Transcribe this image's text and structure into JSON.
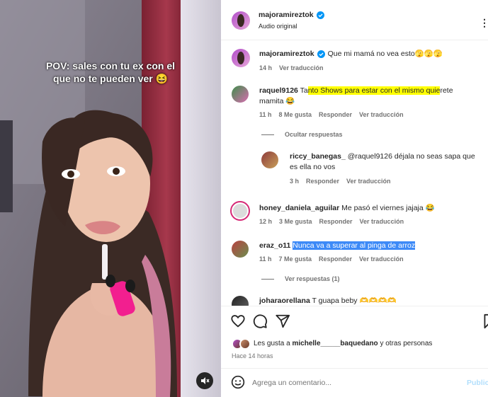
{
  "video": {
    "caption_line1": "POV: sales con tu ex con el",
    "caption_line2": "que no te pueden ver 😆",
    "mute_icon": "speaker-muted-icon"
  },
  "header": {
    "username": "majoramireztok",
    "verified_icon": "verified-badge-icon",
    "audio": "Audio original",
    "more_icon": "more-options-icon"
  },
  "caption": {
    "username": "majoramireztok",
    "text": "Que mi mamá no vea esto🫣🫣🫣",
    "time": "14 h",
    "translate": "Ver traducción"
  },
  "comments": [
    {
      "username": "raquel9126",
      "text_pre": "Ta",
      "text_highlight": "nto Shows para estar con el mismo quie",
      "text_post": "rete mamita 😂",
      "highlight_color": "#ffff00",
      "time": "11 h",
      "likes": "8 Me gusta",
      "reply": "Responder",
      "translate": "Ver traducción",
      "hide_replies": "Ocultar respuestas"
    },
    {
      "username": "riccy_banegas_",
      "text": "@raquel9126 déjala no seas sapa que es ella no vos",
      "time": "3 h",
      "reply": "Responder",
      "translate": "Ver traducción"
    },
    {
      "username": "honey_daniela_aguilar",
      "text": "Me pasó el viernes jajaja 😂",
      "time": "12 h",
      "likes": "3 Me gusta",
      "reply": "Responder",
      "translate": "Ver traducción"
    },
    {
      "username": "eraz_o11",
      "text_highlight": "Nunca va a superar al pinga de arroz",
      "highlight_color": "#3d8af7",
      "time": "11 h",
      "likes": "7 Me gusta",
      "reply": "Responder",
      "translate": "Ver traducción",
      "view_replies": "Ver respuestas (1)"
    },
    {
      "username": "joharaorellana",
      "text": "T guapa beby 🫶🫶🫶🫶"
    }
  ],
  "actions": {
    "like_icon": "heart-icon",
    "comment_icon": "comment-icon",
    "share_icon": "share-icon",
    "save_icon": "bookmark-icon"
  },
  "likes": {
    "prefix": "Les gusta a",
    "user": "michelle_____baquedano",
    "suffix": "y otras personas"
  },
  "timestamp": "Hace 14 horas",
  "comment_box": {
    "emoji_icon": "emoji-icon",
    "placeholder": "Agrega un comentario...",
    "post": "Publicar"
  },
  "colors": {
    "verified": "#0095f6",
    "muted_text": "#737373",
    "accent": "#0095f6"
  }
}
